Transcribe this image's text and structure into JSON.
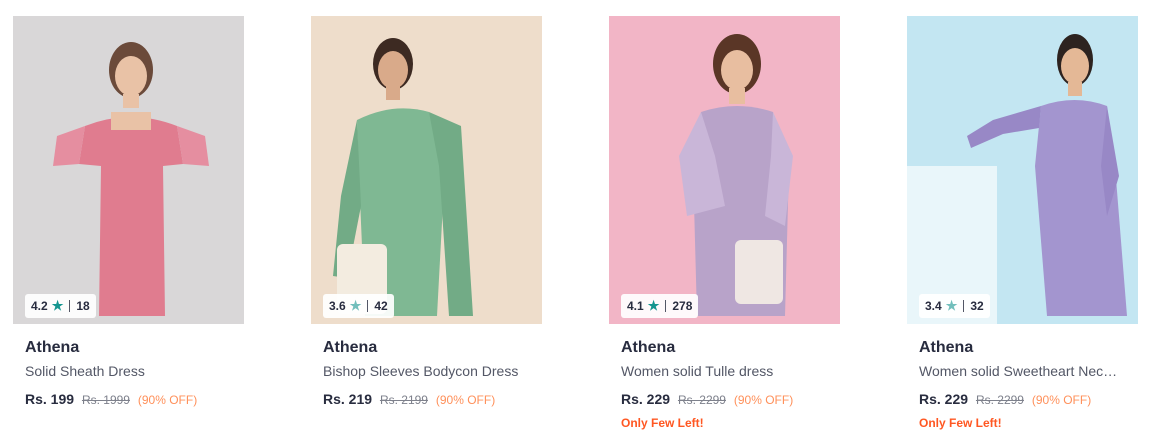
{
  "products": [
    {
      "brand": "Athena",
      "name": "Solid Sheath Dress",
      "price": "Rs. 199",
      "mrp": "Rs. 1999",
      "discount": "(90% OFF)",
      "rating": "4.2",
      "rating_count": "18",
      "stock_note": "",
      "bg_color": "#d9d7d8",
      "dress_color": "#e07c8f",
      "star_color": "#14958f"
    },
    {
      "brand": "Athena",
      "name": "Bishop Sleeves Bodycon Dress",
      "price": "Rs. 219",
      "mrp": "Rs. 2199",
      "discount": "(90% OFF)",
      "rating": "3.6",
      "rating_count": "42",
      "stock_note": "",
      "bg_color": "#eeddcb",
      "dress_color": "#7fb893",
      "star_color": "#72bfbc"
    },
    {
      "brand": "Athena",
      "name": "Women solid Tulle dress",
      "price": "Rs. 229",
      "mrp": "Rs. 2299",
      "discount": "(90% OFF)",
      "rating": "4.1",
      "rating_count": "278",
      "stock_note": "Only Few Left!",
      "bg_color": "#f2b5c6",
      "dress_color": "#b8a3c9",
      "star_color": "#14958f"
    },
    {
      "brand": "Athena",
      "name": "Women solid Sweetheart Neck Bodycon Dress",
      "price": "Rs. 229",
      "mrp": "Rs. 2299",
      "discount": "(90% OFF)",
      "rating": "3.4",
      "rating_count": "32",
      "stock_note": "Only Few Left!",
      "bg_color": "#c3e6f2",
      "dress_color": "#a395cf",
      "star_color": "#72bfbc"
    }
  ]
}
